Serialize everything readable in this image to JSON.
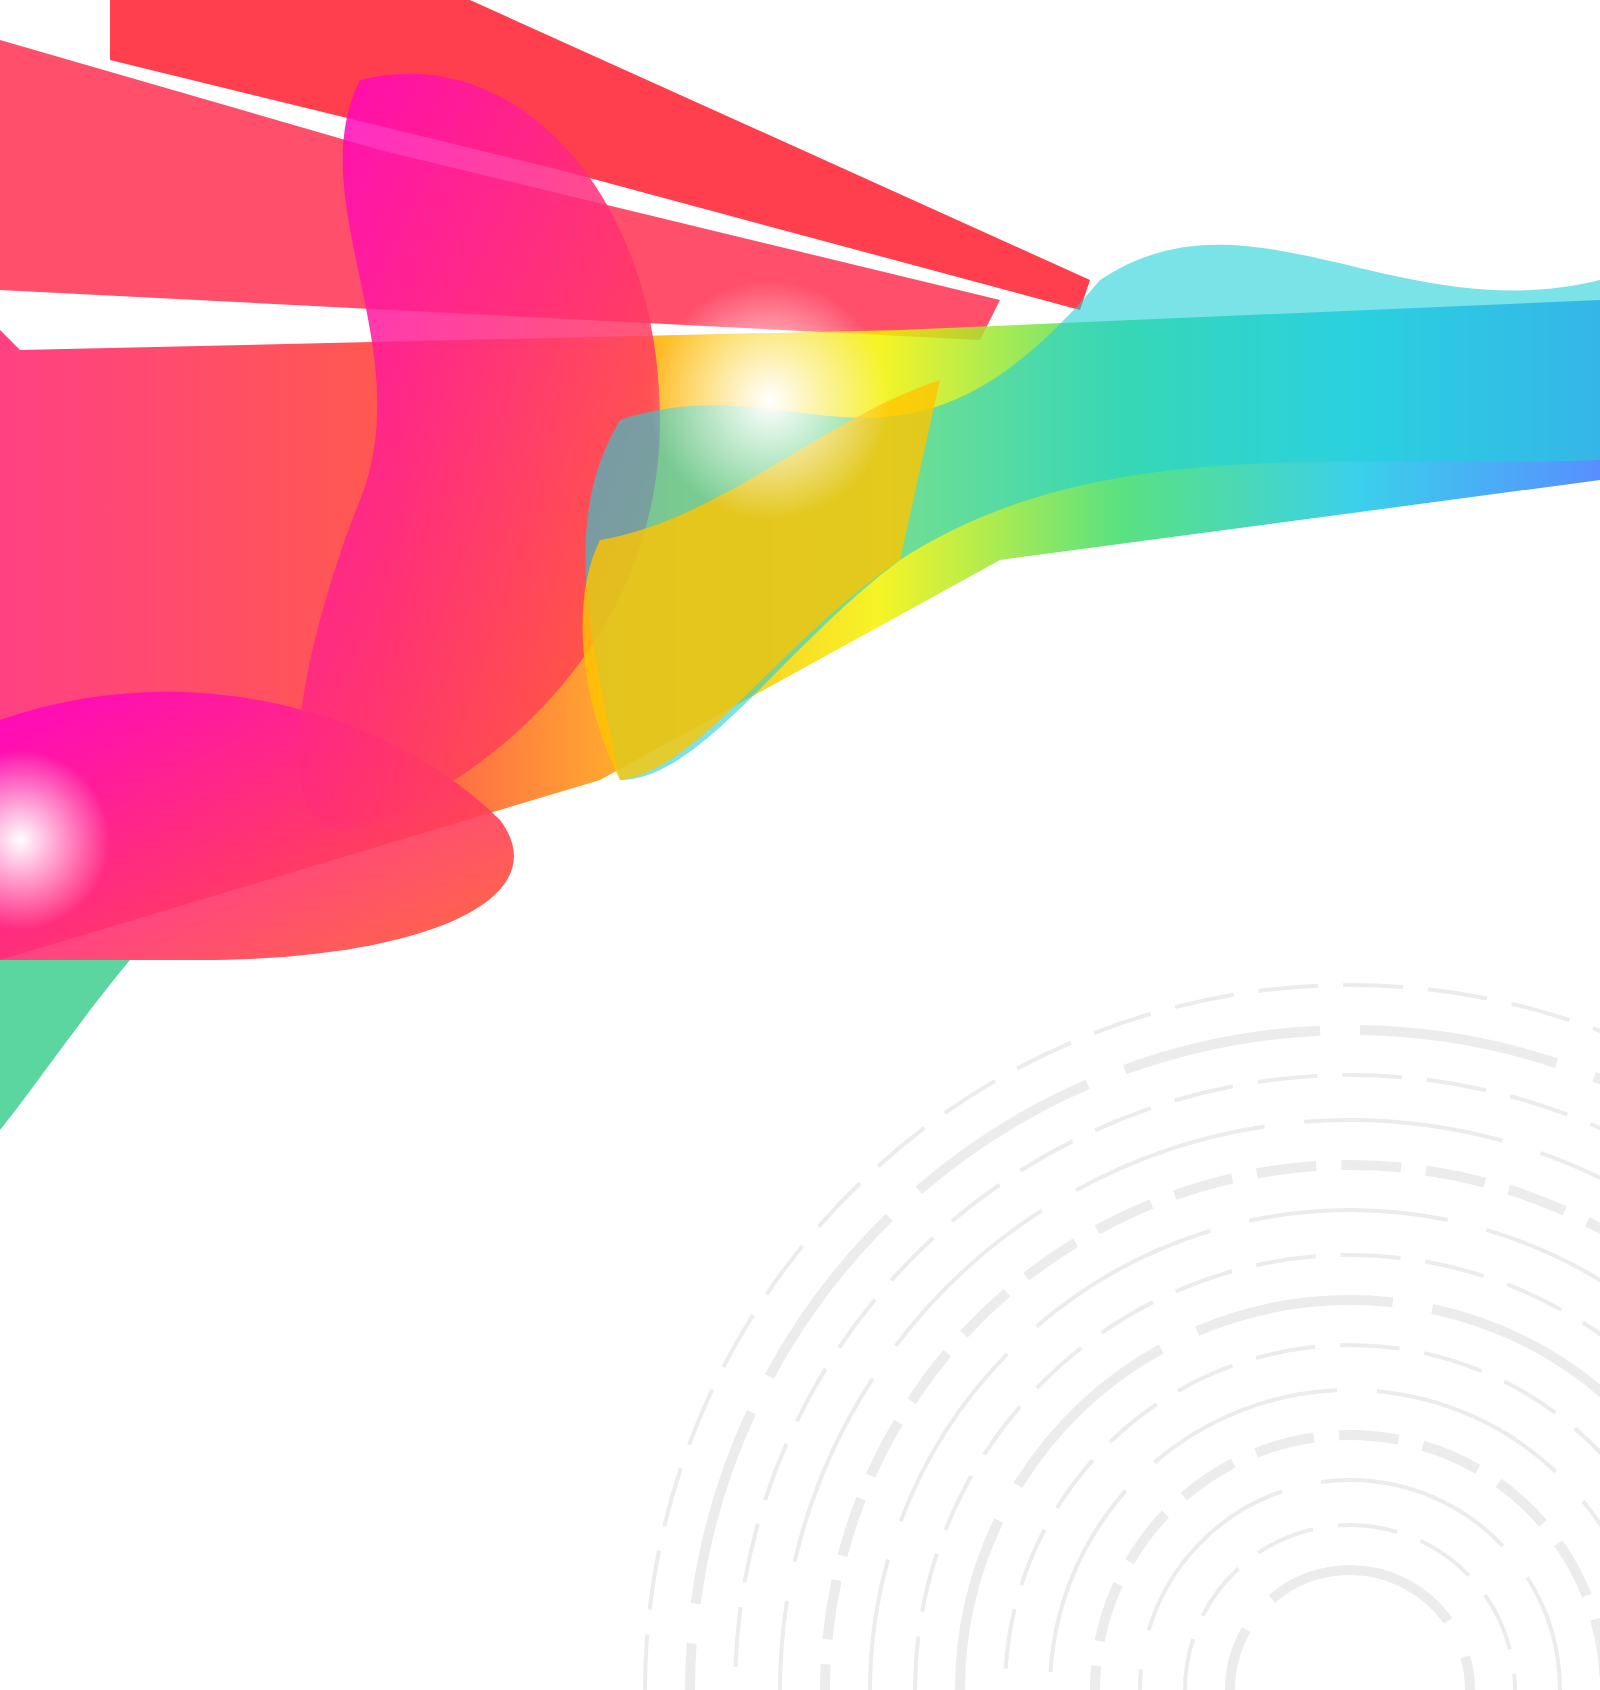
{
  "artwork": {
    "kind": "rainbow-waves"
  }
}
